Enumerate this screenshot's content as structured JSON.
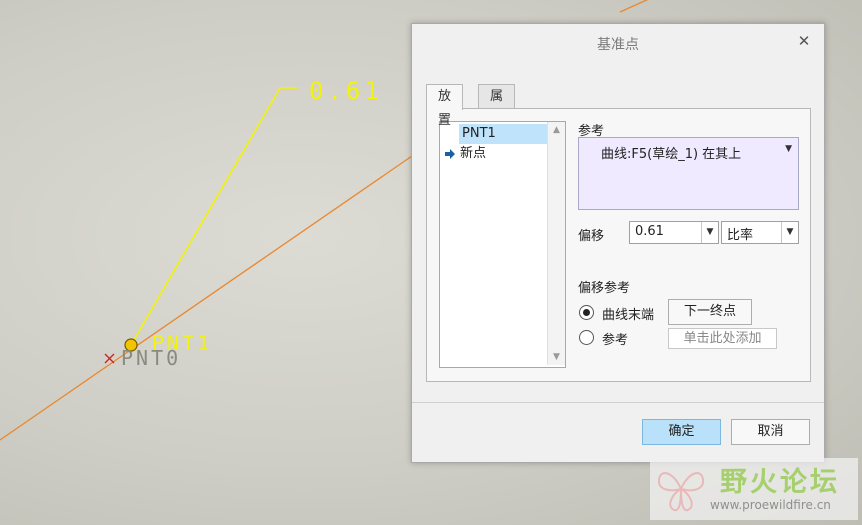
{
  "canvas": {
    "dimension_value": "0.61",
    "point_new_label": "PNT1",
    "point_old_label": "PNT0",
    "colors": {
      "curve": "#e8882e",
      "leader": "#f2f20a",
      "point_fill": "#f4c400",
      "marker": "#d02020"
    }
  },
  "dialog": {
    "title": "基准点",
    "close_icon": "close-icon",
    "tabs": [
      {
        "label": "放置"
      },
      {
        "label": "属性"
      }
    ],
    "point_list": {
      "items": [
        {
          "label": "PNT1",
          "selected": true
        },
        {
          "label": "新点",
          "arrow_icon": "arrow-right-icon"
        }
      ]
    },
    "references": {
      "label": "参考",
      "value": "曲线:F5(草绘_1)  在其上"
    },
    "offset": {
      "label": "偏移",
      "value": "0.61",
      "type": "比率"
    },
    "offset_reference": {
      "label": "偏移参考",
      "option_curve_end": "曲线末端",
      "option_reference": "参考",
      "selected": "曲线末端",
      "next_end_button": "下一终点",
      "reference_placeholder": "单击此处添加"
    },
    "buttons": {
      "ok": "确定",
      "cancel": "取消"
    }
  },
  "watermark": {
    "name": "野火论坛",
    "url": "www.proewildfire.cn"
  }
}
